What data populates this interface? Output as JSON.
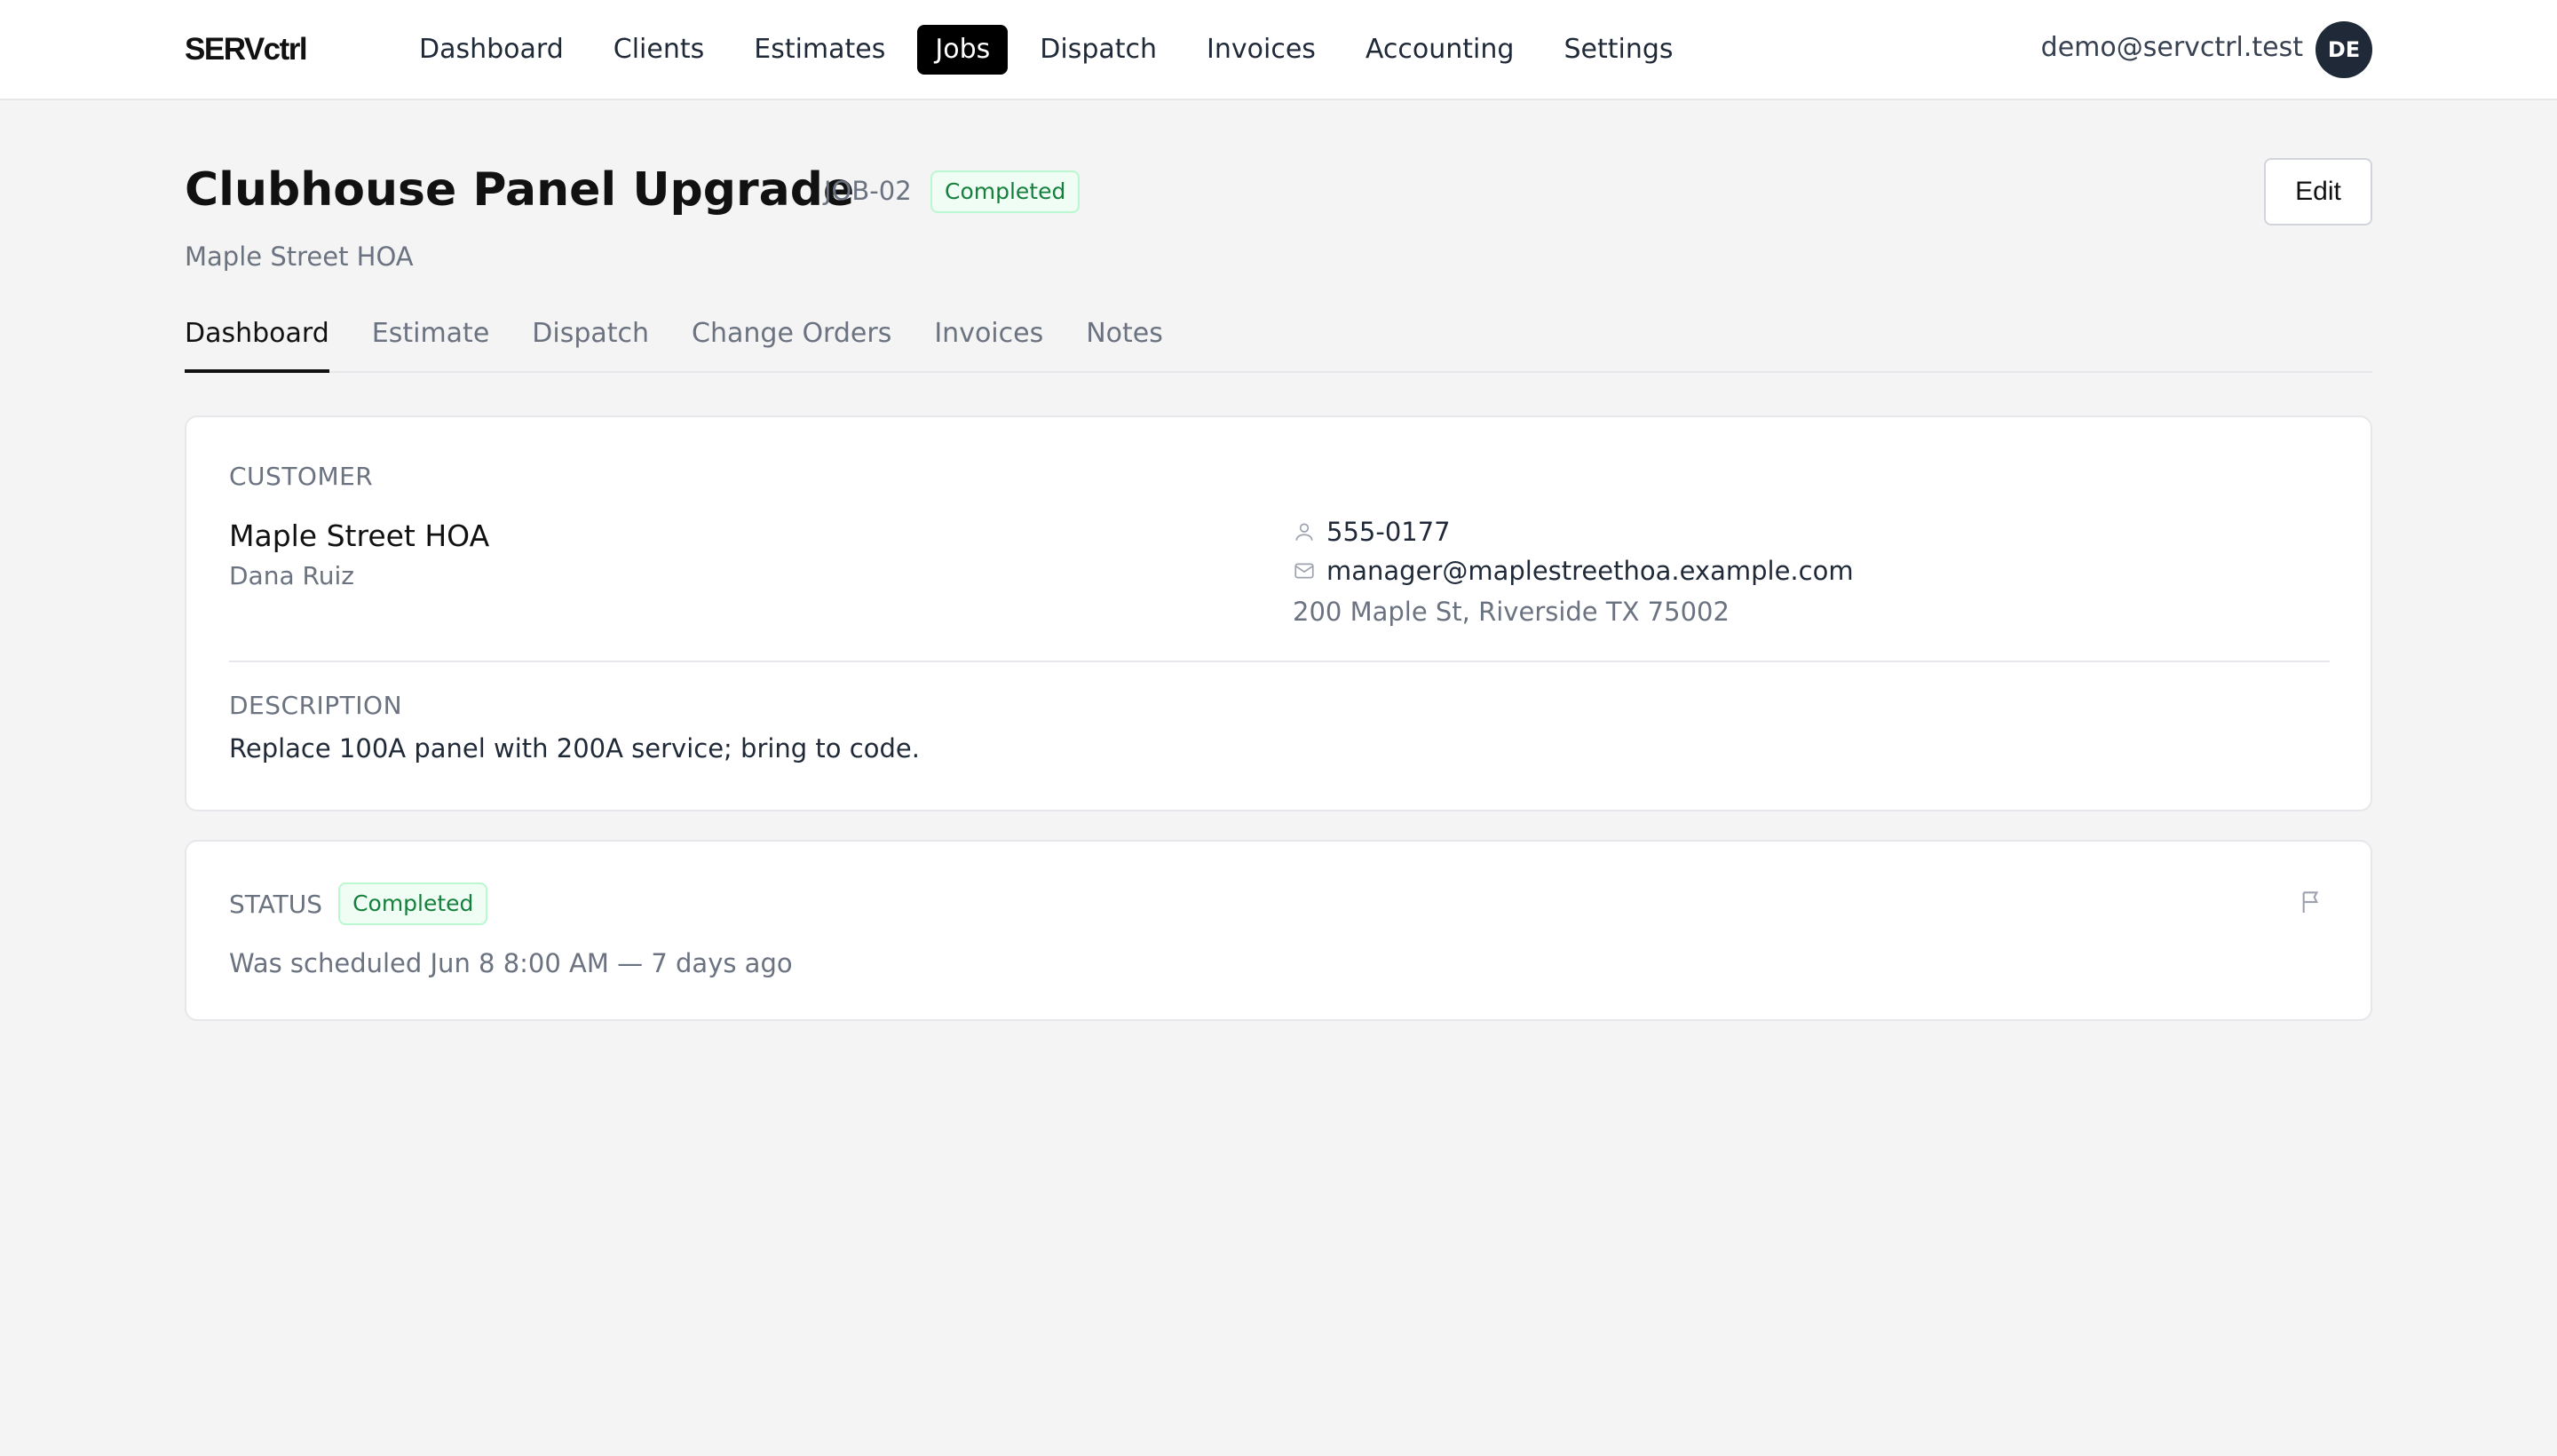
{
  "app": {
    "logo": "SERVctrl",
    "nav": [
      {
        "label": "Dashboard",
        "active": false
      },
      {
        "label": "Clients",
        "active": false
      },
      {
        "label": "Estimates",
        "active": false
      },
      {
        "label": "Jobs",
        "active": true
      },
      {
        "label": "Dispatch",
        "active": false
      },
      {
        "label": "Invoices",
        "active": false
      },
      {
        "label": "Accounting",
        "active": false
      },
      {
        "label": "Settings",
        "active": false
      }
    ],
    "user_email": "demo@servctrl.test",
    "avatar_initials": "DE"
  },
  "job": {
    "title": "Clubhouse Panel Upgrade",
    "id": "JOB-02",
    "status": "Completed",
    "client_name": "Maple Street HOA",
    "edit_label": "Edit"
  },
  "tabs": [
    {
      "label": "Dashboard",
      "active": true
    },
    {
      "label": "Estimate",
      "active": false
    },
    {
      "label": "Dispatch",
      "active": false
    },
    {
      "label": "Change Orders",
      "active": false
    },
    {
      "label": "Invoices",
      "active": false
    },
    {
      "label": "Notes",
      "active": false
    }
  ],
  "customer": {
    "section_label": "CUSTOMER",
    "name": "Maple Street HOA",
    "contact": "Dana Ruiz",
    "phone": "555-0177",
    "email": "manager@maplestreethoa.example.com",
    "address": "200 Maple St, Riverside TX 75002"
  },
  "description": {
    "section_label": "DESCRIPTION",
    "text": "Replace 100A panel with 200A service; bring to code."
  },
  "status_card": {
    "section_label": "STATUS",
    "badge": "Completed",
    "schedule_text": "Was scheduled Jun 8 8:00 AM — 7 days ago"
  },
  "colors": {
    "accent": "#000000",
    "badge_green_text": "#15803d",
    "badge_green_bg": "#f0fdf4",
    "avatar_bg": "#1f2937"
  },
  "icons": {
    "phone": "person-icon",
    "email": "mail-icon",
    "status": "flag-icon"
  }
}
